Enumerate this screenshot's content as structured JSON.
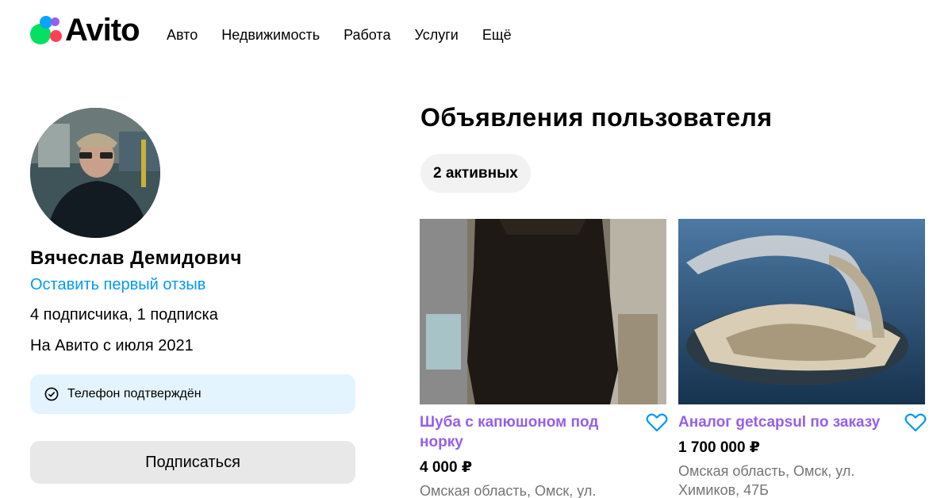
{
  "header": {
    "logo_text": "Avito",
    "nav": [
      "Авто",
      "Недвижимость",
      "Работа",
      "Услуги",
      "Ещё"
    ]
  },
  "profile": {
    "name": "Вячеслав Демидович",
    "review_link": "Оставить первый отзыв",
    "subscribers": "4 подписчика, 1 подписка",
    "since": "На Авито с июля 2021",
    "verified_label": "Телефон подтверждён",
    "subscribe_button": "Подписаться"
  },
  "listings": {
    "title": "Объявления пользователя",
    "active_chip": "2 активных",
    "items": [
      {
        "title": "Шуба с капюшоном под норку",
        "price": "4 000 ₽",
        "location": "Омская область, Омск, ул."
      },
      {
        "title": "Аналог getcapsul по заказу",
        "price": "1 700 000 ₽",
        "location": "Омская область, Омск, ул. Химиков, 47Б"
      }
    ]
  },
  "colors": {
    "link_blue": "#0099f7",
    "title_purple": "#965eeb",
    "verified_bg": "#e3f4ff",
    "button_gray": "#e8e8e8",
    "muted_text": "#757575"
  },
  "icons": {
    "verified": "check-circle-icon",
    "favorite": "heart-icon"
  }
}
